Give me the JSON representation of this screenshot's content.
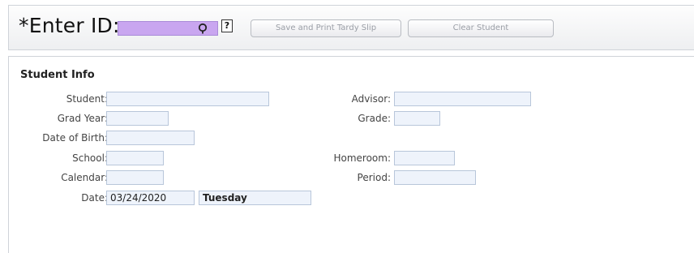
{
  "toolbar": {
    "enter_label": "*Enter ID:",
    "id_value": "",
    "search_icon": "search-icon",
    "help_label": "?",
    "save_label": "Save and Print Tardy Slip",
    "clear_label": "Clear Student"
  },
  "student_info": {
    "title": "Student Info",
    "left_fields": [
      {
        "label": "Student:",
        "value": ""
      },
      {
        "label": "Grad Year:",
        "value": ""
      },
      {
        "label": "Date of Birth:",
        "value": ""
      },
      {
        "label": "School:",
        "value": ""
      },
      {
        "label": "Calendar:",
        "value": ""
      },
      {
        "label": "Date:",
        "value": "03/24/2020"
      }
    ],
    "day_value": "Tuesday",
    "right_fields": [
      {
        "label": "Advisor:",
        "value": ""
      },
      {
        "label": "Grade:",
        "value": ""
      },
      {
        "label": "Homeroom:",
        "value": ""
      },
      {
        "label": "Period:",
        "value": ""
      }
    ]
  },
  "colors": {
    "id_input_bg": "#c9a6f0",
    "field_bg": "#eef3fb",
    "field_border": "#b8c6da"
  }
}
